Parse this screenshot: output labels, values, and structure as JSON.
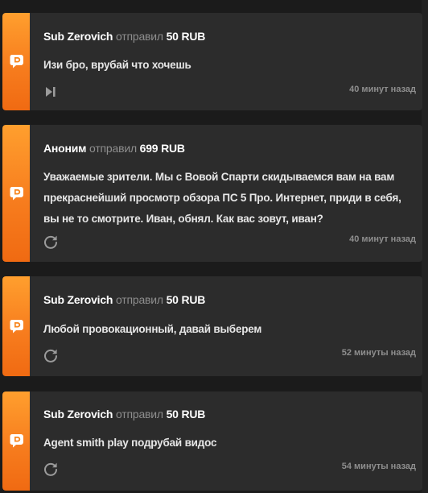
{
  "donations": [
    {
      "sender": "Sub Zerovich",
      "verb": "отправил",
      "amount": "50 RUB",
      "message": "Изи бро, врубай что хочешь",
      "time": "40 минут назад",
      "action_icon": "skip-icon"
    },
    {
      "sender": "Аноним",
      "verb": "отправил",
      "amount": "699 RUB",
      "message": "Уважаемые зрители. Мы с Вовой Спарти скидываемся вам на вам прекраснейший просмотр обзора ПС 5 Про. Интернет, приди в себя, вы не то смотрите. Иван, обнял. Как вас зовут, иван?",
      "time": "40 минут назад",
      "action_icon": "replay-icon"
    },
    {
      "sender": "Sub Zerovich",
      "verb": "отправил",
      "amount": "50 RUB",
      "message": "Любой провокационный, давай выберем",
      "time": "52 минуты назад",
      "action_icon": "replay-icon"
    },
    {
      "sender": "Sub Zerovich",
      "verb": "отправил",
      "amount": "50 RUB",
      "message": "Agent smith play подрубай видос",
      "time": "54 минуты назад",
      "action_icon": "replay-icon"
    }
  ],
  "colors": {
    "accent": "#f7861f",
    "card_bg": "#2c2c2c",
    "page_bg": "#1b1b1b",
    "muted": "#8e8e8e"
  },
  "platform_icon": "donationalerts-icon"
}
